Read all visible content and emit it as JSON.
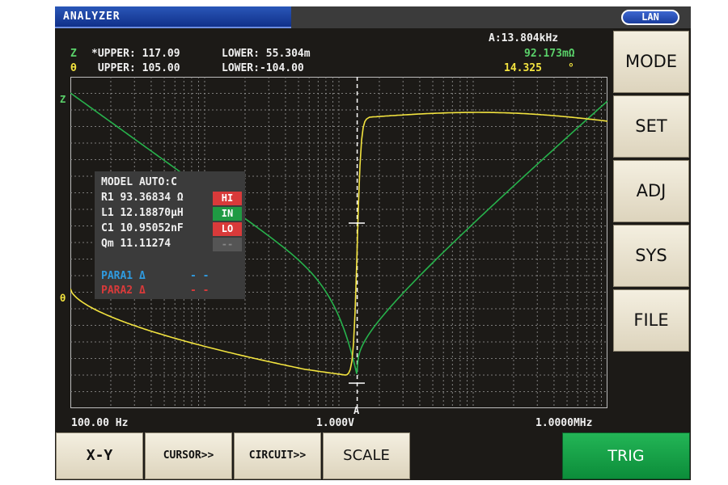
{
  "header": {
    "title": "ANALYZER",
    "lan_label": "LAN"
  },
  "readout": {
    "z": {
      "label": "Z",
      "upper": "*UPPER: 117.09",
      "lower": "LOWER: 55.304m"
    },
    "theta": {
      "label": "θ",
      "upper": " UPPER: 105.00",
      "lower": "LOWER:-104.00"
    },
    "cursor": {
      "freq": "A:13.804kHz",
      "z_value": "92.173mΩ",
      "theta_value": "14.325",
      "theta_unit": "°"
    }
  },
  "side_menu": [
    "MODE",
    "SET",
    "ADJ",
    "SYS",
    "FILE"
  ],
  "bottom_menu": {
    "xy": "X-Y",
    "cursor": "CURSOR>>",
    "circuit": "CIRCUIT>>",
    "scale": "SCALE",
    "trig": "TRIG"
  },
  "plot": {
    "z_axis_label": "Z",
    "theta_axis_label": "θ",
    "x_start": "100.00 Hz",
    "x_mid": "1.000V",
    "x_end": "1.0000MHz",
    "cursor_label": "A",
    "cursor_position_fraction": 0.534,
    "colors": {
      "z_trace": "#27b24c",
      "theta_trace": "#f2e33f",
      "grid": "#9a9a9a"
    }
  },
  "circuit": {
    "model": "MODEL AUTO:C",
    "r1": "R1 93.36834 Ω",
    "l1": "L1 12.18870μH",
    "c1": "C1 10.95052nF",
    "qm": "Qm 11.11274",
    "judgements": [
      {
        "text": "HI",
        "color": "#d93a3a"
      },
      {
        "text": "IN",
        "color": "#1f9a43"
      },
      {
        "text": "LO",
        "color": "#d93a3a"
      },
      {
        "text": "--",
        "color": "#555555"
      }
    ],
    "para1": "PARA1 Δ",
    "para1_value": "- -",
    "para2": "PARA2 Δ",
    "para2_value": "- -"
  }
}
